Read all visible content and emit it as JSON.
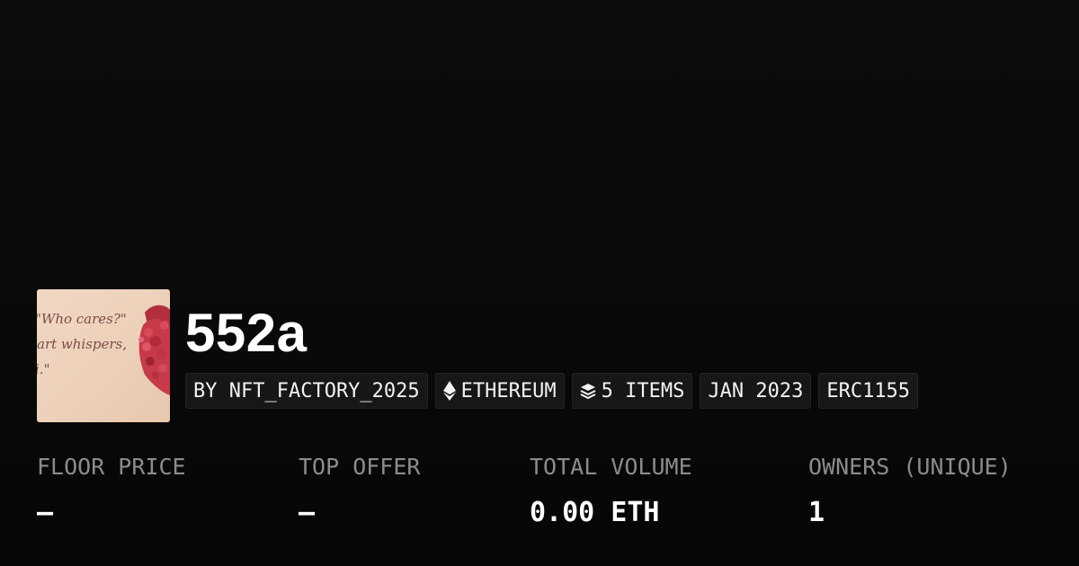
{
  "collection": {
    "title": "552a",
    "thumbnail_text": [
      "\"Who cares?\"",
      "art whispers,",
      "i.\""
    ]
  },
  "badges": [
    {
      "label": "BY NFT_FACTORY_2025",
      "icon": ""
    },
    {
      "label": "ETHEREUM",
      "icon": "ethereum-icon"
    },
    {
      "label": "5 ITEMS",
      "icon": "layers-icon"
    },
    {
      "label": "JAN 2023",
      "icon": ""
    },
    {
      "label": "ERC1155",
      "icon": ""
    }
  ],
  "stats": [
    {
      "label": "FLOOR PRICE",
      "value": "–"
    },
    {
      "label": "TOP OFFER",
      "value": "–"
    },
    {
      "label": "TOTAL VOLUME",
      "value": "0.00 ETH"
    },
    {
      "label": "OWNERS (UNIQUE)",
      "value": "1"
    }
  ],
  "colors": {
    "background": "#0b0b0b",
    "badge_background": "#171717",
    "label_gray": "#8c8c8c",
    "text": "#ffffff"
  }
}
